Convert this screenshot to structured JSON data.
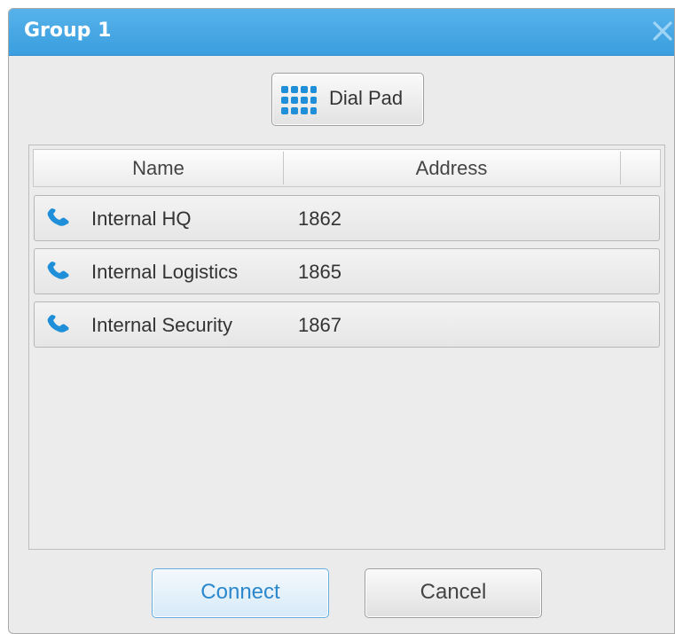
{
  "window": {
    "title": "Group 1"
  },
  "toolbar": {
    "dial_pad_label": "Dial Pad",
    "dial_pad_icon": "keypad-icon"
  },
  "list": {
    "columns": [
      "Name",
      "Address"
    ],
    "rows": [
      {
        "name": "Internal HQ",
        "address": "1862",
        "icon": "phone-icon"
      },
      {
        "name": "Internal Logistics",
        "address": "1865",
        "icon": "phone-icon"
      },
      {
        "name": "Internal Security",
        "address": "1867",
        "icon": "phone-icon"
      }
    ]
  },
  "buttons": {
    "connect_label": "Connect",
    "cancel_label": "Cancel"
  },
  "colors": {
    "accent": "#3a9edf",
    "titlebar": "#4aa8e6",
    "icon": "#1e8fd8",
    "dialog_background": "#ebebeb"
  }
}
